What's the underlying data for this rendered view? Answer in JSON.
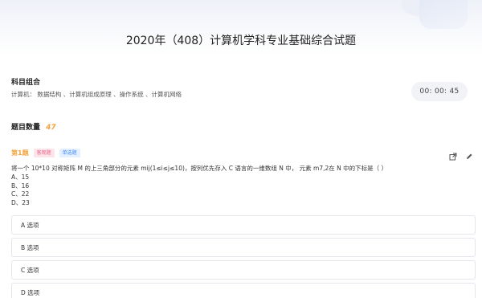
{
  "header": {
    "title": "2020年（408）计算机学科专业基础综合试题"
  },
  "subjects": {
    "label": "科目组合",
    "detail": "计算机： 数据结构 、计算机组成原理 、操作系统 、计算机网络"
  },
  "timer": {
    "value": "00: 00: 45"
  },
  "question_count": {
    "label": "题目数量",
    "value": "47"
  },
  "question": {
    "number": "第1题",
    "tag_type": "客观题",
    "tag_kind": "单选题",
    "text": "将一个 10*10 对称矩阵 M 的上三角部分的元素 mij(1≤i≤j≤10)，按列优先存入 C 语言的一维数组 N 中， 元素 m7,2在 N 中的下标是（ ）",
    "choices": [
      "A、15",
      "B、16",
      "C、22",
      "D、23"
    ],
    "options": [
      "A 选项",
      "B 选项",
      "C 选项",
      "D 选项"
    ]
  },
  "icons": {
    "open": "external-link-icon",
    "edit": "pencil-icon"
  },
  "colors": {
    "accent": "#f2a23c",
    "tag_pink": "#e8698a",
    "tag_blue": "#4a8ff0"
  }
}
